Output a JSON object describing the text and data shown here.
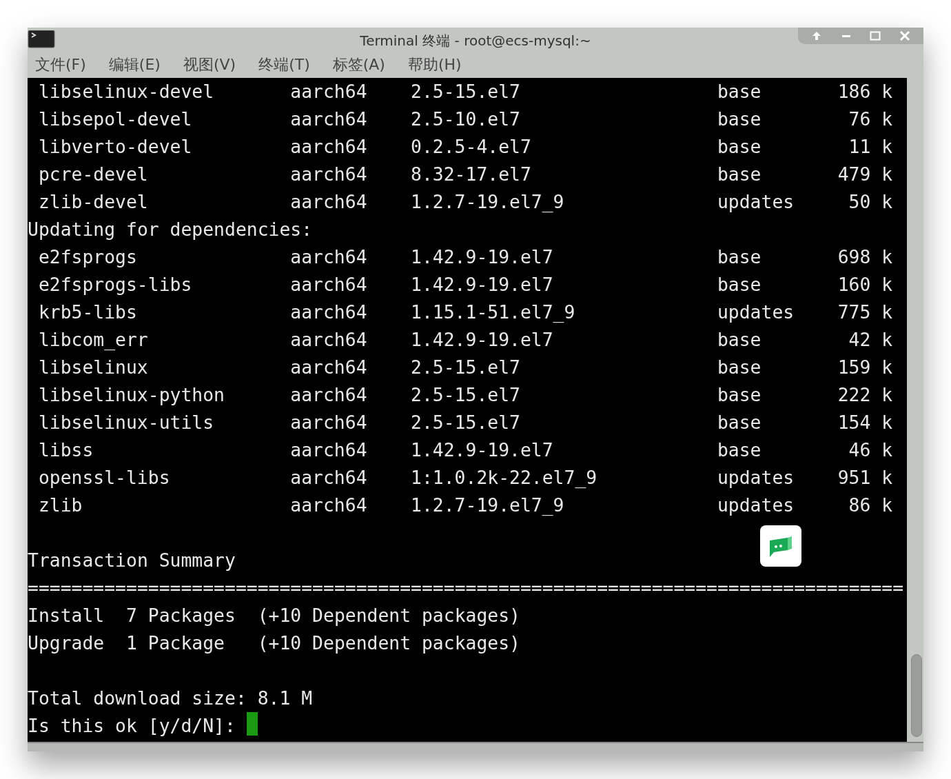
{
  "window": {
    "title": "Terminal 终端 - root@ecs-mysql:~"
  },
  "menu": [
    "文件(F)",
    "编辑(E)",
    "视图(V)",
    "终端(T)",
    "标签(A)",
    "帮助(H)"
  ],
  "lines": [
    {
      "kind": "package",
      "name": "libselinux-devel",
      "arch": "aarch64",
      "version": "2.5-15.el7",
      "repo": "base",
      "size": "186 k"
    },
    {
      "kind": "package",
      "name": "libsepol-devel",
      "arch": "aarch64",
      "version": "2.5-10.el7",
      "repo": "base",
      "size": "76 k"
    },
    {
      "kind": "package",
      "name": "libverto-devel",
      "arch": "aarch64",
      "version": "0.2.5-4.el7",
      "repo": "base",
      "size": "11 k"
    },
    {
      "kind": "package",
      "name": "pcre-devel",
      "arch": "aarch64",
      "version": "8.32-17.el7",
      "repo": "base",
      "size": "479 k"
    },
    {
      "kind": "package",
      "name": "zlib-devel",
      "arch": "aarch64",
      "version": "1.2.7-19.el7_9",
      "repo": "updates",
      "size": "50 k"
    },
    {
      "kind": "text",
      "text": "Updating for dependencies:"
    },
    {
      "kind": "package",
      "name": "e2fsprogs",
      "arch": "aarch64",
      "version": "1.42.9-19.el7",
      "repo": "base",
      "size": "698 k"
    },
    {
      "kind": "package",
      "name": "e2fsprogs-libs",
      "arch": "aarch64",
      "version": "1.42.9-19.el7",
      "repo": "base",
      "size": "160 k"
    },
    {
      "kind": "package",
      "name": "krb5-libs",
      "arch": "aarch64",
      "version": "1.15.1-51.el7_9",
      "repo": "updates",
      "size": "775 k"
    },
    {
      "kind": "package",
      "name": "libcom_err",
      "arch": "aarch64",
      "version": "1.42.9-19.el7",
      "repo": "base",
      "size": "42 k"
    },
    {
      "kind": "package",
      "name": "libselinux",
      "arch": "aarch64",
      "version": "2.5-15.el7",
      "repo": "base",
      "size": "159 k"
    },
    {
      "kind": "package",
      "name": "libselinux-python",
      "arch": "aarch64",
      "version": "2.5-15.el7",
      "repo": "base",
      "size": "222 k"
    },
    {
      "kind": "package",
      "name": "libselinux-utils",
      "arch": "aarch64",
      "version": "2.5-15.el7",
      "repo": "base",
      "size": "154 k"
    },
    {
      "kind": "package",
      "name": "libss",
      "arch": "aarch64",
      "version": "1.42.9-19.el7",
      "repo": "base",
      "size": "46 k"
    },
    {
      "kind": "package",
      "name": "openssl-libs",
      "arch": "aarch64",
      "version": "1:1.0.2k-22.el7_9",
      "repo": "updates",
      "size": "951 k"
    },
    {
      "kind": "package",
      "name": "zlib",
      "arch": "aarch64",
      "version": "1.2.7-19.el7_9",
      "repo": "updates",
      "size": "86 k"
    },
    {
      "kind": "blank"
    },
    {
      "kind": "text",
      "text": "Transaction Summary"
    },
    {
      "kind": "text",
      "text": "================================================================================"
    },
    {
      "kind": "text",
      "text": "Install  7 Packages  (+10 Dependent packages)"
    },
    {
      "kind": "text",
      "text": "Upgrade  1 Package   (+10 Dependent packages)"
    },
    {
      "kind": "blank"
    },
    {
      "kind": "text",
      "text": "Total download size: 8.1 M"
    },
    {
      "kind": "prompt",
      "text": "Is this ok [y/d/N]:",
      "cursor": true
    }
  ]
}
